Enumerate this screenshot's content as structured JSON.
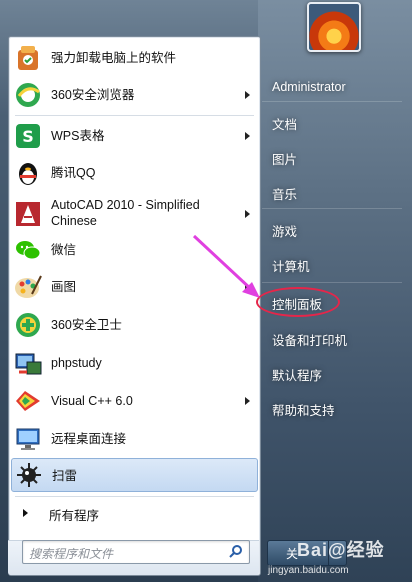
{
  "programs": [
    {
      "label": "强力卸载电脑上的软件",
      "icon": "uninstaller-icon",
      "submenu": false
    },
    {
      "label": "360安全浏览器",
      "icon": "360-browser-icon",
      "submenu": true
    },
    {
      "label": "WPS表格",
      "icon": "wps-spreadsheet-icon",
      "submenu": true
    },
    {
      "label": "腾讯QQ",
      "icon": "qq-penguin-icon",
      "submenu": false
    },
    {
      "label": "AutoCAD 2010 - Simplified",
      "label2": "Chinese",
      "icon": "autocad-icon",
      "submenu": true
    },
    {
      "label": "微信",
      "icon": "wechat-icon",
      "submenu": false
    },
    {
      "label": "画图",
      "icon": "paint-palette-icon",
      "submenu": true
    },
    {
      "label": "360安全卫士",
      "icon": "360-safeguard-icon",
      "submenu": false
    },
    {
      "label": "phpstudy",
      "icon": "phpstudy-icon",
      "submenu": false
    },
    {
      "label": "Visual C++ 6.0",
      "icon": "visual-cpp-icon",
      "submenu": true
    },
    {
      "label": "远程桌面连接",
      "icon": "remote-desktop-icon",
      "submenu": false
    },
    {
      "label": "扫雷",
      "icon": "minesweeper-icon",
      "submenu": false
    }
  ],
  "all_programs": "所有程序",
  "search": {
    "placeholder": "搜索程序和文件"
  },
  "right_items": [
    "Administrator",
    "文档",
    "图片",
    "音乐",
    "游戏",
    "计算机",
    "控制面板",
    "设备和打印机",
    "默认程序",
    "帮助和支持"
  ],
  "shutdown_label": "关",
  "watermark": {
    "logo": "Bai@经验",
    "url": "jingyan.baidu.com"
  },
  "colors": {
    "highlight_ring": "#e5264a",
    "arrow": "#e040e0",
    "hover": "#c4d9f2"
  }
}
